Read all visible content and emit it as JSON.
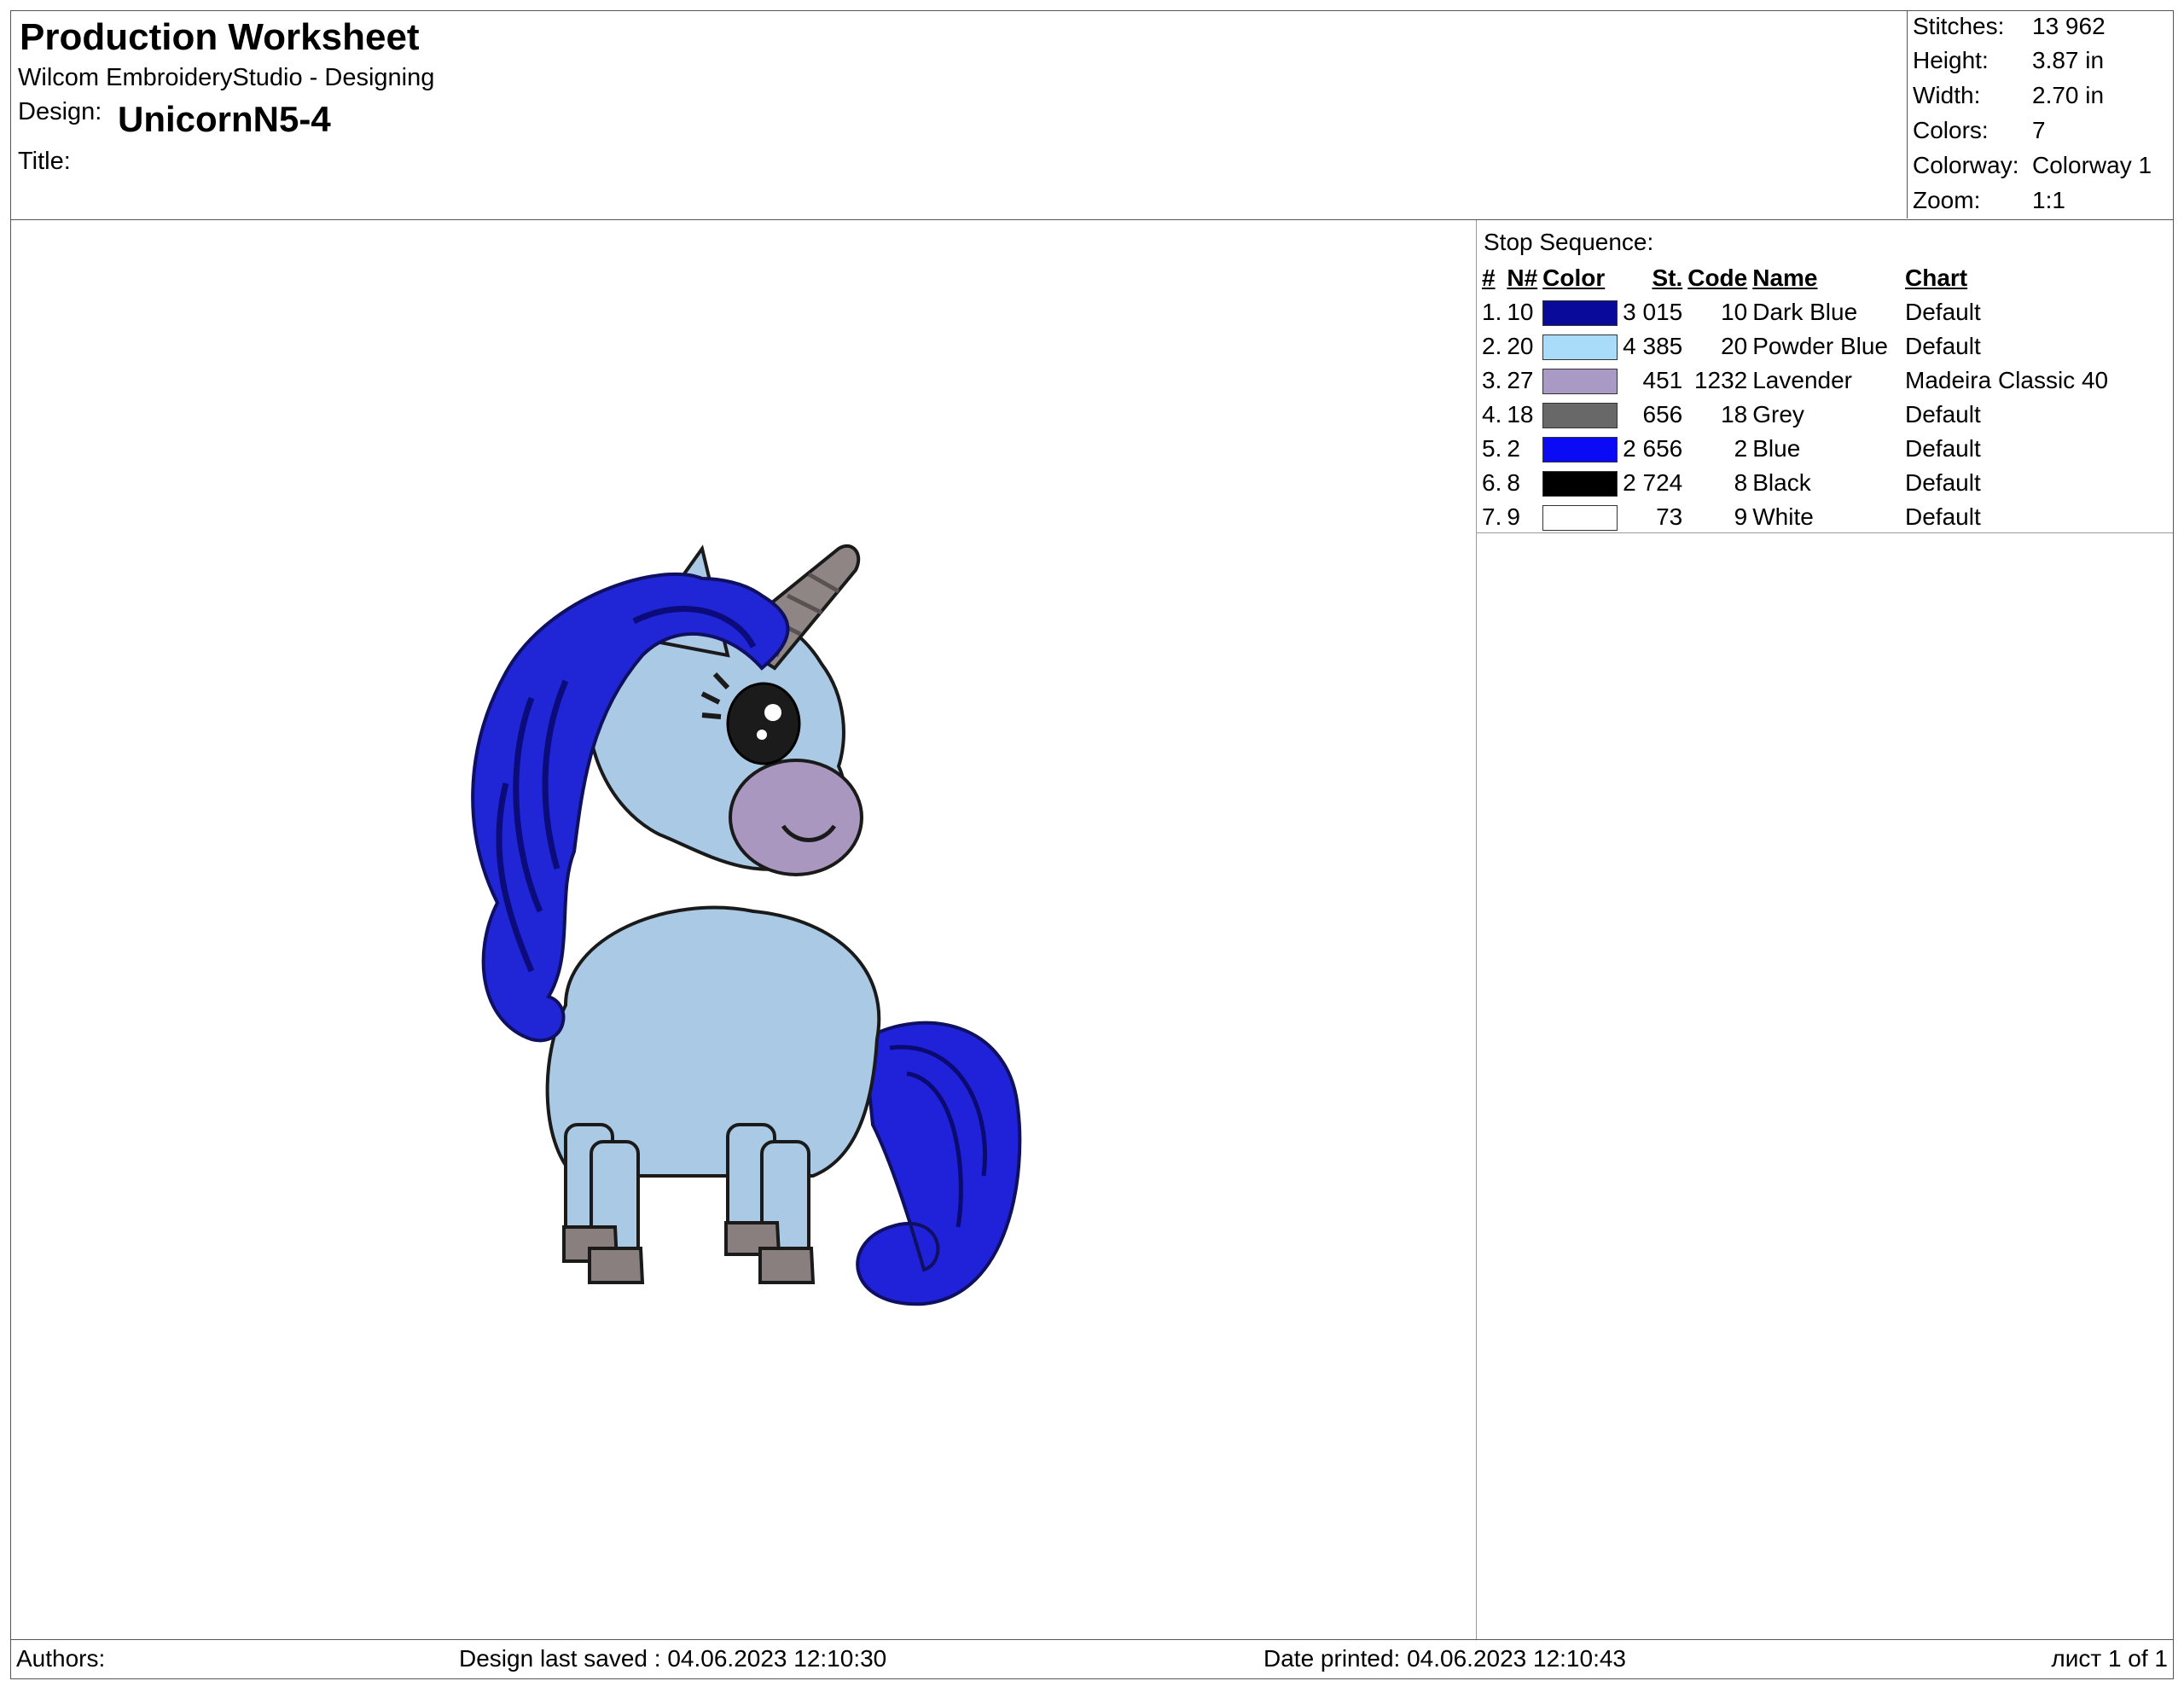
{
  "header": {
    "title": "Production Worksheet",
    "app": "Wilcom EmbroideryStudio - Designing",
    "design_label": "Design:",
    "design_value": "UnicornN5-4",
    "title_label": "Title:"
  },
  "stats": [
    {
      "label": "Stitches:",
      "value": "13 962"
    },
    {
      "label": "Height:",
      "value": "3.87 in"
    },
    {
      "label": "Width:",
      "value": "2.70 in"
    },
    {
      "label": "Colors:",
      "value": "7"
    },
    {
      "label": "Colorway:",
      "value": "Colorway 1"
    },
    {
      "label": "Zoom:",
      "value": "1:1"
    }
  ],
  "stop_sequence": {
    "title": "Stop Sequence:",
    "headers": [
      "#",
      "N#",
      "Color",
      "St.",
      "Code",
      "Name",
      "Chart"
    ],
    "rows": [
      {
        "idx": "1.",
        "n": "10",
        "color": "#0a0a9a",
        "st": "3 015",
        "code": "10",
        "name": "Dark Blue",
        "chart": "Default"
      },
      {
        "idx": "2.",
        "n": "20",
        "color": "#a8dcf8",
        "st": "4 385",
        "code": "20",
        "name": "Powder Blue",
        "chart": "Default"
      },
      {
        "idx": "3.",
        "n": "27",
        "color": "#a89ac4",
        "st": "451",
        "code": "1232",
        "name": "Lavender",
        "chart": "Madeira Classic 40"
      },
      {
        "idx": "4.",
        "n": "18",
        "color": "#686868",
        "st": "656",
        "code": "18",
        "name": "Grey",
        "chart": "Default"
      },
      {
        "idx": "5.",
        "n": "2",
        "color": "#0a0af4",
        "st": "2 656",
        "code": "2",
        "name": "Blue",
        "chart": "Default"
      },
      {
        "idx": "6.",
        "n": "8",
        "color": "#000000",
        "st": "2 724",
        "code": "8",
        "name": "Black",
        "chart": "Default"
      },
      {
        "idx": "7.",
        "n": "9",
        "color": "#ffffff",
        "st": "73",
        "code": "9",
        "name": "White",
        "chart": "Default"
      }
    ]
  },
  "footer": {
    "authors": "Authors:",
    "last_saved": "Design last saved : 04.06.2023 12:10:30",
    "printed": "Date printed: 04.06.2023 12:10:43",
    "page": "лист 1 of 1"
  }
}
